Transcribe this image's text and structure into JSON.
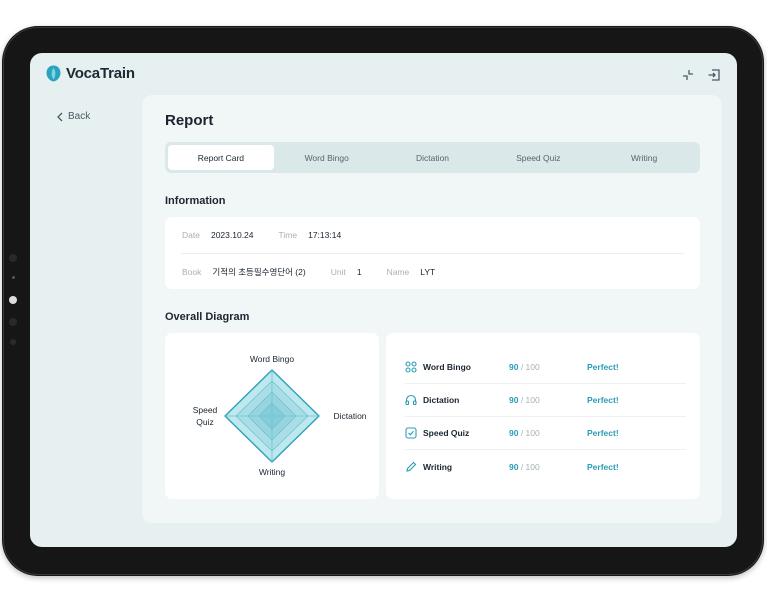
{
  "app": {
    "name": "VocaTrain"
  },
  "nav": {
    "back_label": "Back"
  },
  "page": {
    "title": "Report"
  },
  "tabs": [
    {
      "label": "Report Card",
      "active": true
    },
    {
      "label": "Word Bingo",
      "active": false
    },
    {
      "label": "Dictation",
      "active": false
    },
    {
      "label": "Speed Quiz",
      "active": false
    },
    {
      "label": "Writing",
      "active": false
    }
  ],
  "information": {
    "heading": "Information",
    "date_label": "Date",
    "date": "2023.10.24",
    "time_label": "Time",
    "time": "17:13:14",
    "book_label": "Book",
    "book": "기적의 초등필수영단어 (2)",
    "unit_label": "Unit",
    "unit": "1",
    "name_label": "Name",
    "name": "LYT"
  },
  "overall": {
    "heading": "Overall Diagram",
    "radar_labels": {
      "top": "Word Bingo",
      "right": "Dictation",
      "bottom": "Writing",
      "left_line1": "Speed",
      "left_line2": "Quiz"
    },
    "scores": [
      {
        "name": "Word Bingo",
        "icon": "grid-icon",
        "score": "90",
        "max": " / 100",
        "result": "Perfect!"
      },
      {
        "name": "Dictation",
        "icon": "headphones-icon",
        "score": "90",
        "max": " / 100",
        "result": "Perfect!"
      },
      {
        "name": "Speed Quiz",
        "icon": "checkbox-icon",
        "score": "90",
        "max": " / 100",
        "result": "Perfect!"
      },
      {
        "name": "Writing",
        "icon": "pencil-icon",
        "score": "90",
        "max": " / 100",
        "result": "Perfect!"
      }
    ]
  },
  "colors": {
    "accent": "#2a9db6",
    "radar_fill": "#bfe7ee",
    "background": "#e7f0f1"
  }
}
